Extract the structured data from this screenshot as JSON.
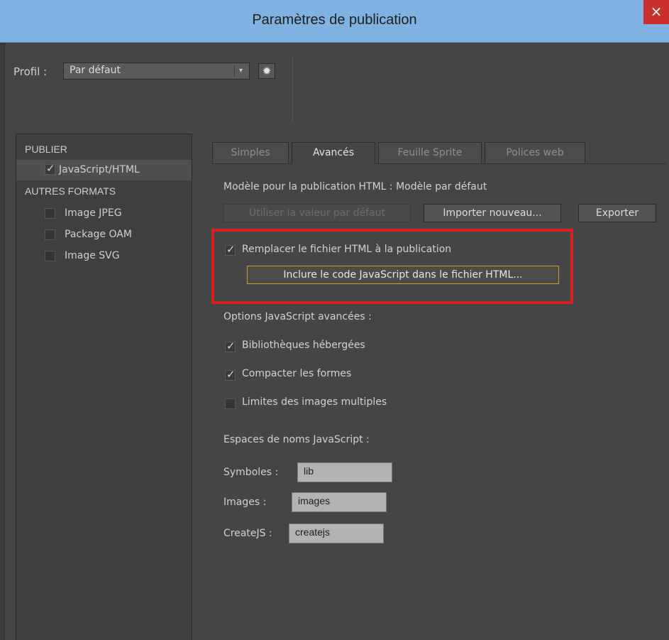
{
  "window": {
    "title": "Paramètres de publication",
    "close_glyph": "×"
  },
  "profile": {
    "label": "Profil :",
    "selected": "Par défaut",
    "arrow_glyph": "▾",
    "gear_glyph": "✹"
  },
  "sidebar": {
    "publish_header": "PUBLIER",
    "other_header": "AUTRES FORMATS",
    "items": [
      {
        "label": "JavaScript/HTML",
        "checked": true
      },
      {
        "label": "Image JPEG",
        "checked": false
      },
      {
        "label": "Package OAM",
        "checked": false
      },
      {
        "label": "Image SVG",
        "checked": false
      }
    ]
  },
  "tabs": [
    {
      "label": "Simples",
      "active": false
    },
    {
      "label": "Avancés",
      "active": true
    },
    {
      "label": "Feuille Sprite",
      "active": false
    },
    {
      "label": "Polices web",
      "active": false
    }
  ],
  "advanced": {
    "template_label": "Modèle pour la publication HTML : Modèle par défaut",
    "use_default_button": "Utiliser la valeur par défaut",
    "import_button": "Importer nouveau...",
    "export_button": "Exporter",
    "overwrite_html": {
      "label": "Remplacer le fichier HTML à la publication",
      "checked": true
    },
    "include_js_button": "Inclure le code JavaScript dans le fichier HTML...",
    "js_options_header": "Options JavaScript avancées :",
    "hosted_libs": {
      "label": "Bibliothèques hébergées",
      "checked": true
    },
    "compact_shapes": {
      "label": "Compacter les formes",
      "checked": true
    },
    "multiframe_bounds": {
      "label": "Limites des images multiples",
      "checked": false
    },
    "namespaces_header": "Espaces de noms JavaScript :",
    "symbols": {
      "label": "Symboles :",
      "value": "lib"
    },
    "images": {
      "label": "Images :",
      "value": "images"
    },
    "createjs": {
      "label": "CreateJS :",
      "value": "createjs"
    }
  },
  "colors": {
    "titlebar": "#7fb1e3",
    "close": "#c7302c",
    "highlight": "#d81e1e",
    "focus_border": "#d59a2a"
  }
}
